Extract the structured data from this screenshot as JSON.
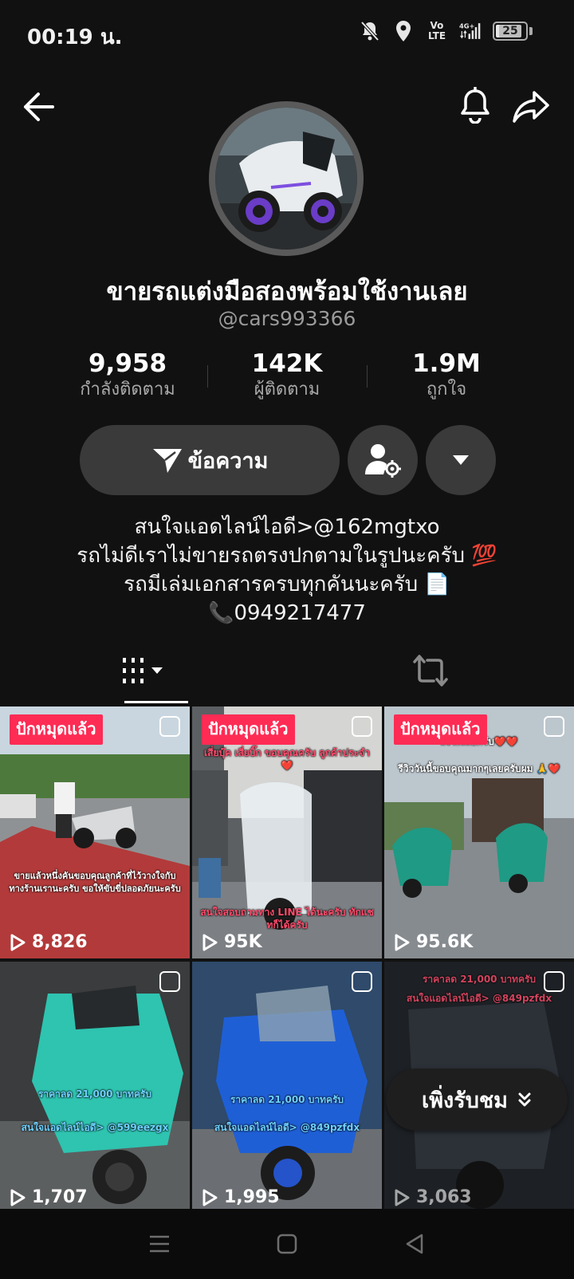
{
  "status_bar": {
    "time": "00:19 น.",
    "network": "Vo\nLTE",
    "signal_label": "4G+",
    "battery_level": "25"
  },
  "profile": {
    "display_name": "ขายรถแต่งมือสองพร้อมใช้งานเลย",
    "username": "@cars993366",
    "stats": [
      {
        "value": "9,958",
        "label": "กำลังติดตาม"
      },
      {
        "value": "142K",
        "label": "ผู้ติดตาม"
      },
      {
        "value": "1.9M",
        "label": "ถูกใจ"
      }
    ],
    "message_button": "ข้อความ",
    "bio": [
      "สนใจแอดไลน์ไอดี>@162mgtxo",
      "รถไม่ดีเราไม่ขายรถตรงปกตามในรูปนะครับ 💯",
      "รถมีเล่มเอกสารครบทุกคันนะครับ 📄",
      "📞0949217477"
    ]
  },
  "videos": [
    {
      "pinned_label": "ปักหมุดแล้ว",
      "views": "8,826",
      "caption": "ขายแล้วหนึ่งคันขอบคุณลูกค้าที่ไว้วางใจกับทางร้านเรานะครับ ขอให้ขับขี่ปลอดภัยนะครับ"
    },
    {
      "pinned_label": "ปักหมุดแล้ว",
      "views": "95K",
      "caption_top": "เสี่ยบุ๊ค เสี่ยบิ๊ก ขอบคุณครับ ลูกค้าประจำ❤️",
      "caption": "สนใจสอบถามทาง LINE ได้นะครับ ทักแชทก็ได้ครับ"
    },
    {
      "pinned_label": "ปักหมุดแล้ว",
      "views": "95.6K",
      "caption_top": "ส่งให้เลยครับ❤️❤️",
      "caption": "รีวิววันนี้ขอบคุณมากๆเลยครับผม 🙏❤️"
    },
    {
      "pinned_label": "",
      "views": "1,707",
      "caption": "ราคาลด 21,000 บาทครับ",
      "caption2": "สนใจแอดไลน์ไอดี> @599eezgx"
    },
    {
      "pinned_label": "",
      "views": "1,995",
      "caption": "ราคาลด 21,000 บาทครับ",
      "caption2": "สนใจแอดไลน์ไอดี> @849pzfdx"
    },
    {
      "pinned_label": "",
      "views": "3,063",
      "caption_top": "ราคาลด 21,000 บาทครับ",
      "caption2": "สนใจแอดไลน์ไอดี> @849pzfdx"
    }
  ],
  "watch_more": {
    "label": "เพิ่งรับชม"
  },
  "colors": {
    "background": "#111111",
    "pin_badge": "#fe2c55",
    "button_bg": "#3a3a3a",
    "muted_text": "#9a9a9a"
  },
  "icons": [
    "back-arrow-icon",
    "bell-icon",
    "share-icon",
    "send-icon",
    "add-friend-settings-icon",
    "dropdown-triangle-icon",
    "grid-icon",
    "repost-icon",
    "play-icon",
    "chevron-double-down-icon"
  ]
}
